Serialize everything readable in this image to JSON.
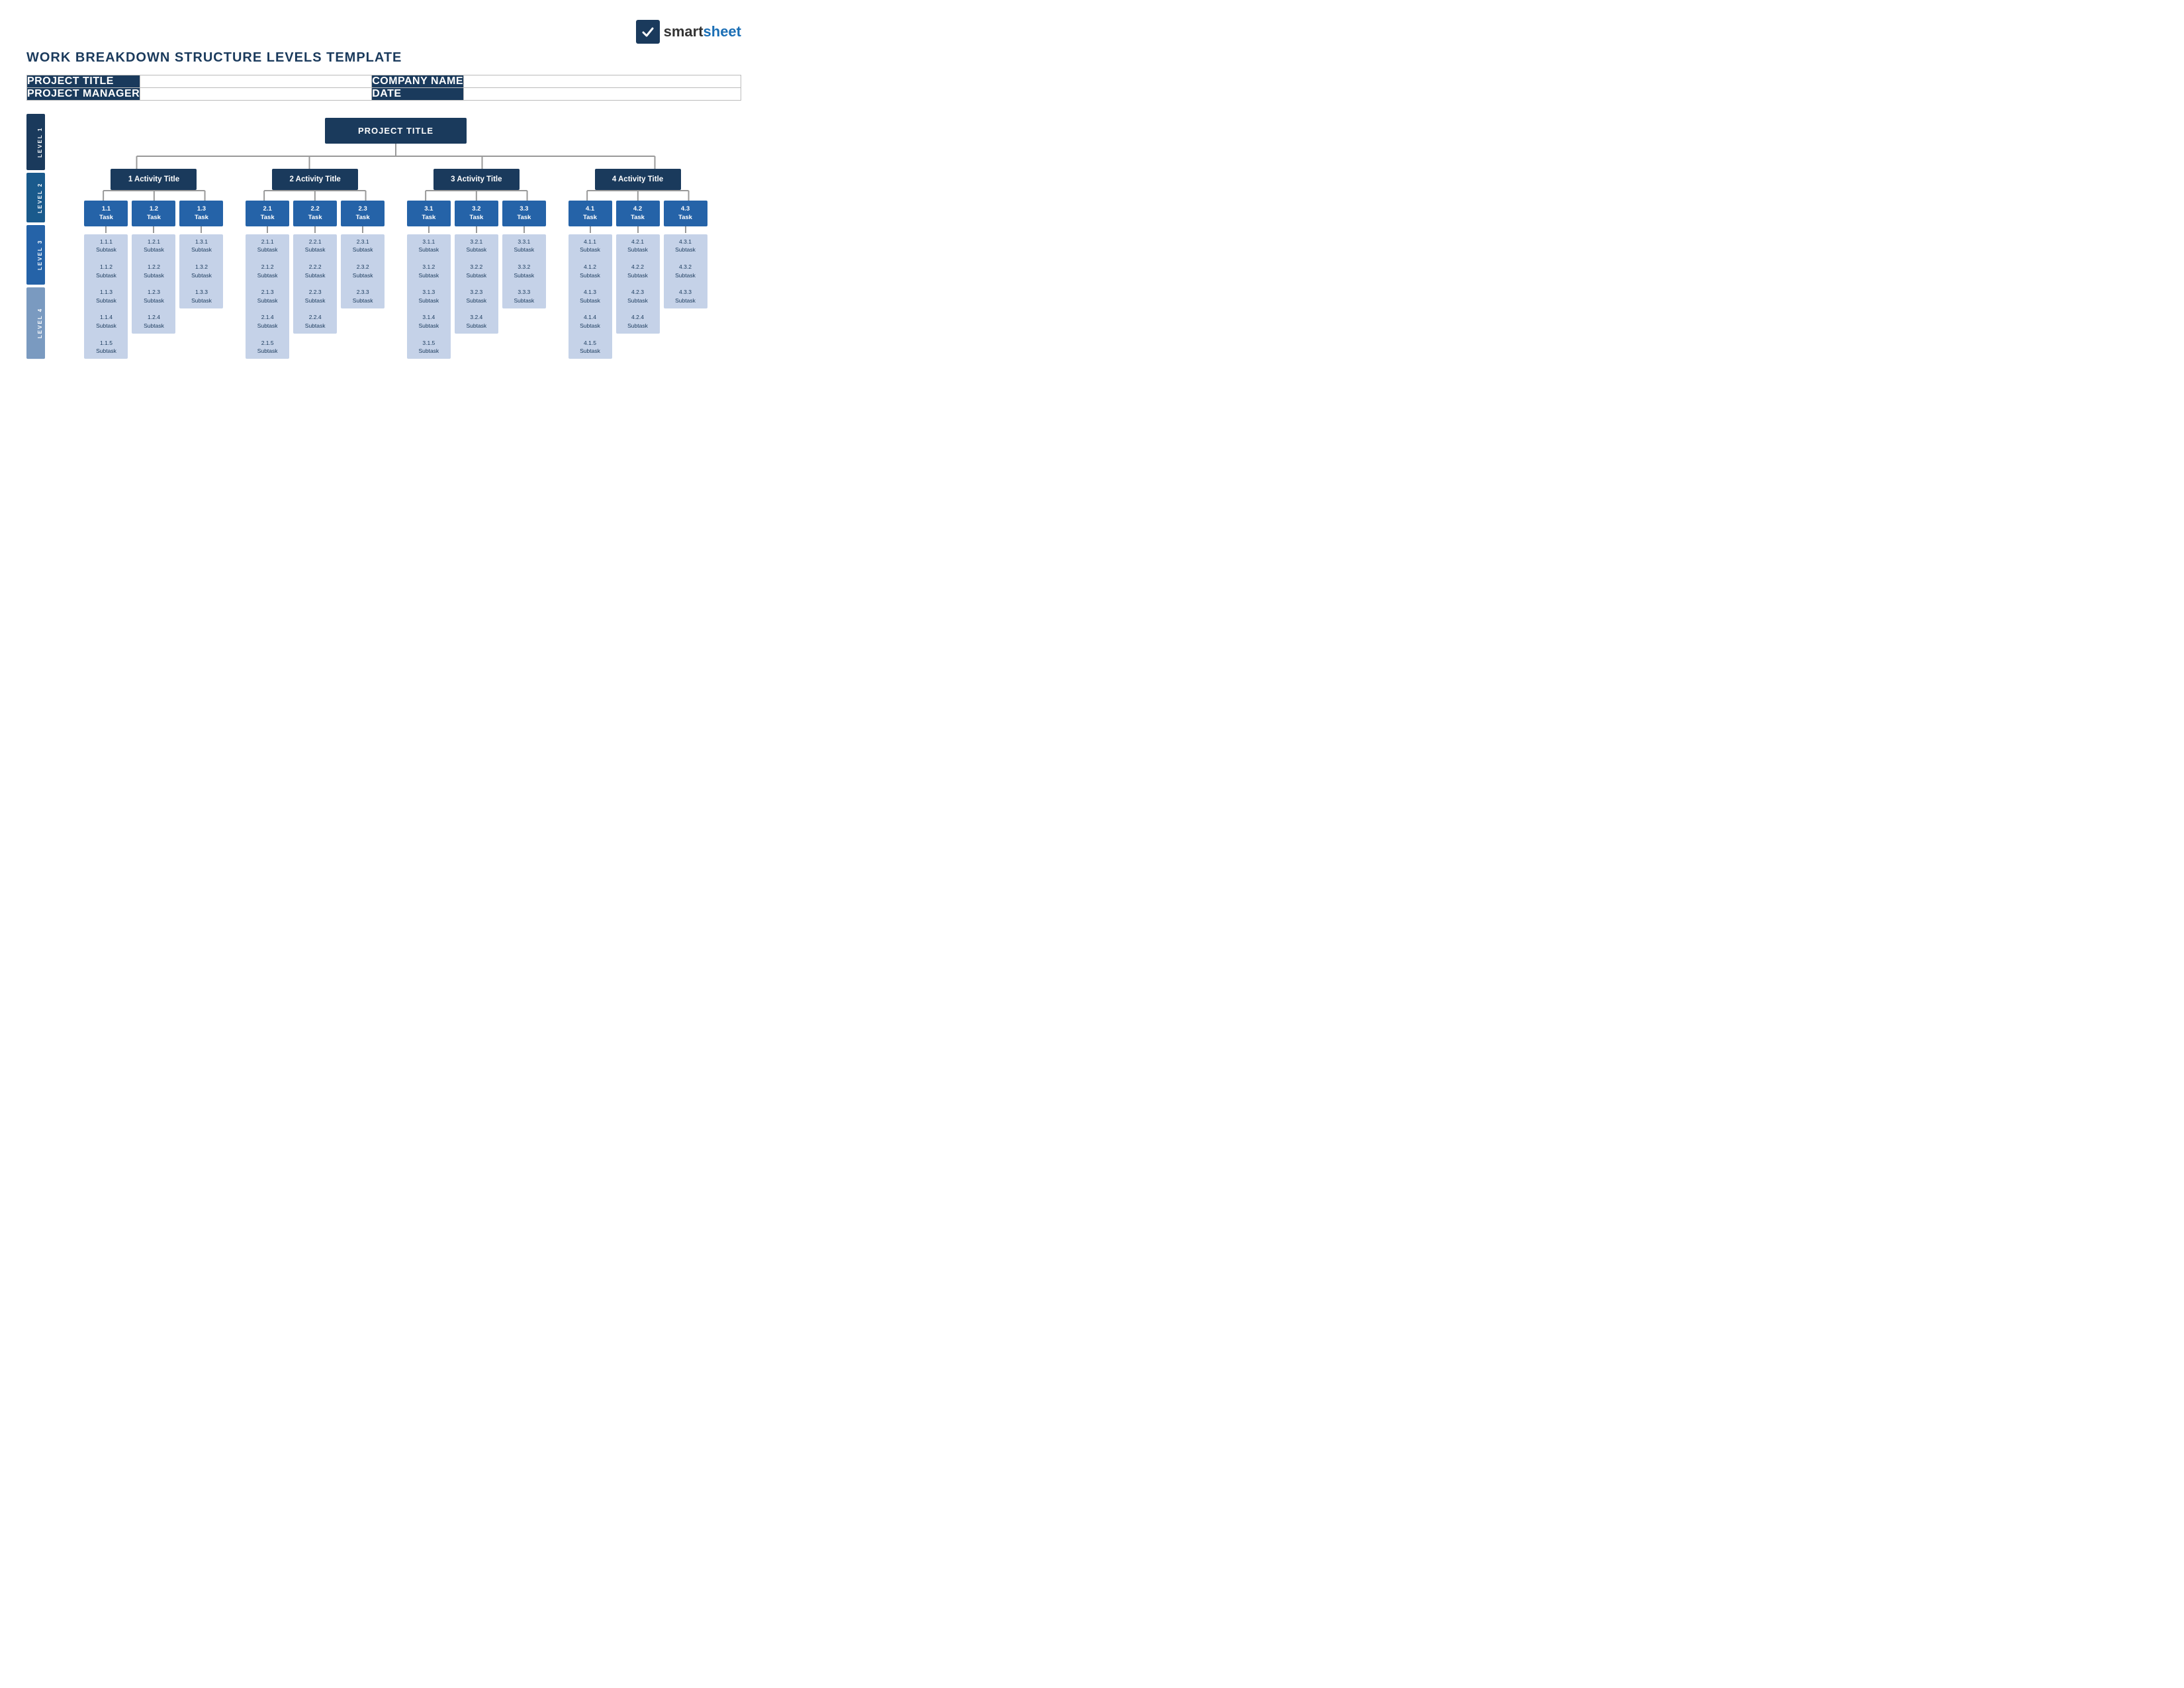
{
  "logo": {
    "brand": "smartsheet",
    "brand_bold": "smart",
    "brand_light": "sheet"
  },
  "title": "WORK BREAKDOWN STRUCTURE LEVELS TEMPLATE",
  "info_fields": {
    "project_title_label": "PROJECT TITLE",
    "project_title_value": "",
    "company_name_label": "COMPANY NAME",
    "company_name_value": "",
    "project_manager_label": "PROJECT MANAGER",
    "project_manager_value": "",
    "date_label": "DATE",
    "date_value": ""
  },
  "levels": {
    "l1": "LEVEL 1",
    "l2": "LEVEL 2",
    "l3": "LEVEL 3",
    "l4": "LEVEL 4"
  },
  "project_node": "PROJECT TITLE",
  "activities": [
    {
      "id": "act1",
      "label": "1 Activity Title",
      "tasks": [
        {
          "id": "t11",
          "label": "1.1\nTask",
          "subtasks": [
            "1.1.1\nSubtask",
            "1.1.2\nSubtask",
            "1.1.3\nSubtask",
            "1.1.4\nSubtask",
            "1.1.5\nSubtask"
          ]
        },
        {
          "id": "t12",
          "label": "1.2\nTask",
          "subtasks": [
            "1.2.1\nSubtask",
            "1.2.2\nSubtask",
            "1.2.3\nSubtask",
            "1.2.4\nSubtask"
          ]
        },
        {
          "id": "t13",
          "label": "1.3\nTask",
          "subtasks": [
            "1.3.1\nSubtask",
            "1.3.2\nSubtask",
            "1.3.3\nSubtask"
          ]
        }
      ]
    },
    {
      "id": "act2",
      "label": "2 Activity Title",
      "tasks": [
        {
          "id": "t21",
          "label": "2.1\nTask",
          "subtasks": [
            "2.1.1\nSubtask",
            "2.1.2\nSubtask",
            "2.1.3\nSubtask",
            "2.1.4\nSubtask",
            "2.1.5\nSubtask"
          ]
        },
        {
          "id": "t22",
          "label": "2.2\nTask",
          "subtasks": [
            "2.2.1\nSubtask",
            "2.2.2\nSubtask",
            "2.2.3\nSubtask",
            "2.2.4\nSubtask"
          ]
        },
        {
          "id": "t23",
          "label": "2.3\nTask",
          "subtasks": [
            "2.3.1\nSubtask",
            "2.3.2\nSubtask",
            "2.3.3\nSubtask"
          ]
        }
      ]
    },
    {
      "id": "act3",
      "label": "3 Activity Title",
      "tasks": [
        {
          "id": "t31",
          "label": "3.1\nTask",
          "subtasks": [
            "3.1.1\nSubtask",
            "3.1.2\nSubtask",
            "3.1.3\nSubtask",
            "3.1.4\nSubtask",
            "3.1.5\nSubtask"
          ]
        },
        {
          "id": "t32",
          "label": "3.2\nTask",
          "subtasks": [
            "3.2.1\nSubtask",
            "3.2.2\nSubtask",
            "3.2.3\nSubtask",
            "3.2.4\nSubtask"
          ]
        },
        {
          "id": "t33",
          "label": "3.3\nTask",
          "subtasks": [
            "3.3.1\nSubtask",
            "3.3.2\nSubtask",
            "3.3.3\nSubtask"
          ]
        }
      ]
    },
    {
      "id": "act4",
      "label": "4 Activity Title",
      "tasks": [
        {
          "id": "t41",
          "label": "4.1\nTask",
          "subtasks": [
            "4.1.1\nSubtask",
            "4.1.2\nSubtask",
            "4.1.3\nSubtask",
            "4.1.4\nSubtask",
            "4.1.5\nSubtask"
          ]
        },
        {
          "id": "t42",
          "label": "4.2\nTask",
          "subtasks": [
            "4.2.1\nSubtask",
            "4.2.2\nSubtask",
            "4.2.3\nSubtask",
            "4.2.4\nSubtask"
          ]
        },
        {
          "id": "t43",
          "label": "4.3\nTask",
          "subtasks": [
            "4.3.1\nSubtask",
            "4.3.2\nSubtask",
            "4.3.3\nSubtask"
          ]
        }
      ]
    }
  ],
  "colors": {
    "dark_navy": "#1a3a5c",
    "medium_blue": "#2563a8",
    "light_blue_bg": "#c5d2e8",
    "connector_gray": "#999999",
    "border_gray": "#bbbbbb"
  }
}
